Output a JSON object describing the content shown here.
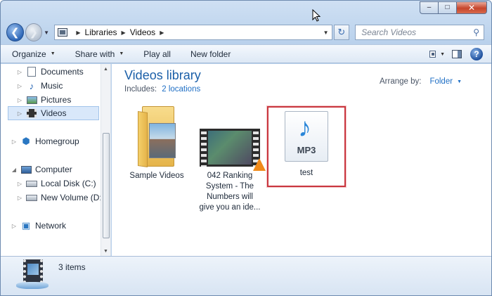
{
  "window": {
    "caption_buttons": {
      "minimize": "–",
      "maximize": "□",
      "close": "✕"
    }
  },
  "address": {
    "crumbs": [
      "Libraries",
      "Videos"
    ],
    "search_placeholder": "Search Videos"
  },
  "toolbar": {
    "organize": "Organize",
    "share_with": "Share with",
    "play_all": "Play all",
    "new_folder": "New folder"
  },
  "nav": {
    "libraries": [
      {
        "label": "Documents",
        "icon": "document-icon"
      },
      {
        "label": "Music",
        "icon": "music-icon"
      },
      {
        "label": "Pictures",
        "icon": "pictures-icon"
      },
      {
        "label": "Videos",
        "icon": "videos-icon",
        "selected": true
      }
    ],
    "homegroup": "Homegroup",
    "computer": "Computer",
    "drives": [
      {
        "label": "Local Disk (C:)"
      },
      {
        "label": "New Volume (D:)"
      }
    ],
    "network": "Network"
  },
  "library": {
    "title": "Videos library",
    "includes_label": "Includes:",
    "includes_link": "2 locations",
    "arrange_label": "Arrange by:",
    "arrange_value": "Folder"
  },
  "files": [
    {
      "name": "Sample Videos",
      "type": "folder"
    },
    {
      "name": [
        "042 Ranking",
        "System - The",
        "Numbers will",
        "give you an ide..."
      ],
      "type": "video"
    },
    {
      "name": "test",
      "type": "mp3",
      "icon_text": "MP3",
      "highlighted": true
    }
  ],
  "status": {
    "items": "3 items"
  }
}
